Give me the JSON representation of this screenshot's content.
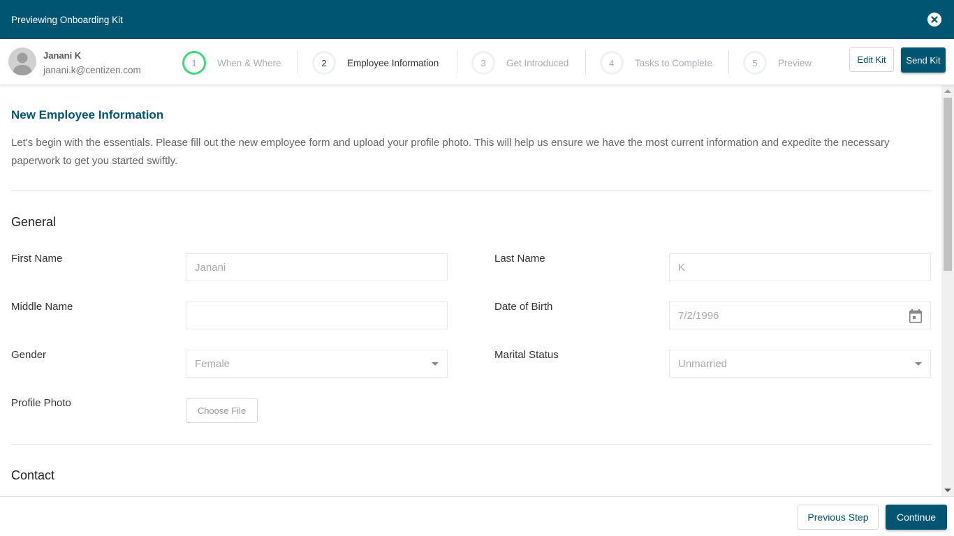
{
  "topbar": {
    "title": "Previewing Onboarding Kit"
  },
  "user": {
    "name": "Janani K",
    "email": "janani.k@centizen.com"
  },
  "steps": [
    {
      "number": "1",
      "label": "When & Where",
      "state": "done"
    },
    {
      "number": "2",
      "label": "Employee Information",
      "state": "active"
    },
    {
      "number": "3",
      "label": "Get Introduced",
      "state": "pending"
    },
    {
      "number": "4",
      "label": "Tasks to Complete",
      "state": "pending"
    },
    {
      "number": "5",
      "label": "Preview",
      "state": "pending"
    }
  ],
  "actions": {
    "edit_kit": "Edit Kit",
    "send_kit": "Send Kit"
  },
  "page": {
    "title": "New Employee Information",
    "intro": "Let's begin with the essentials. Please fill out the new employee form and upload your profile photo. This will help us ensure we have the most current information and expedite the necessary paperwork to get you started swiftly."
  },
  "sections": {
    "general": {
      "title": "General",
      "fields": {
        "first_name": {
          "label": "First Name",
          "value": "Janani"
        },
        "last_name": {
          "label": "Last Name",
          "value": "K"
        },
        "middle_name": {
          "label": "Middle Name",
          "value": ""
        },
        "date_of_birth": {
          "label": "Date of Birth",
          "value": "7/2/1996"
        },
        "gender": {
          "label": "Gender",
          "value": "Female"
        },
        "marital_status": {
          "label": "Marital Status",
          "value": "Unmarried"
        },
        "profile_photo": {
          "label": "Profile Photo",
          "button": "Choose File"
        }
      }
    },
    "contact": {
      "title": "Contact"
    }
  },
  "footer": {
    "previous": "Previous Step",
    "continue": "Continue"
  },
  "colors": {
    "brand": "#005573",
    "step_done": "#3fd97a"
  }
}
